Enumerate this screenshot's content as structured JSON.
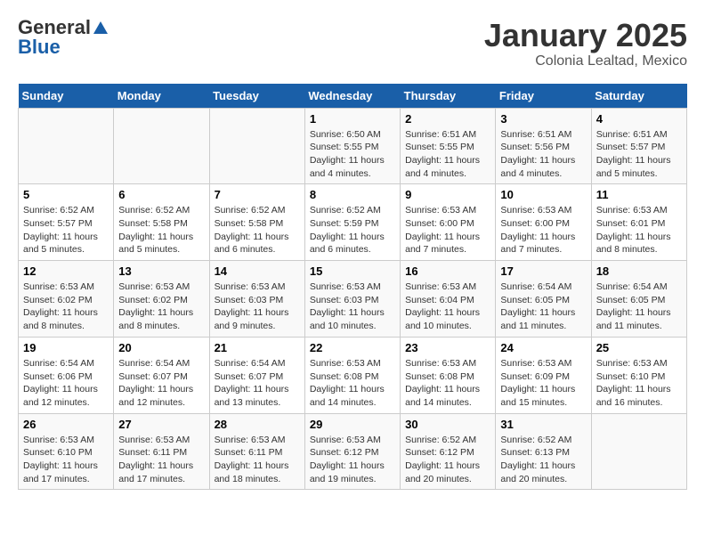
{
  "logo": {
    "general": "General",
    "blue": "Blue"
  },
  "title": "January 2025",
  "subtitle": "Colonia Lealtad, Mexico",
  "days_of_week": [
    "Sunday",
    "Monday",
    "Tuesday",
    "Wednesday",
    "Thursday",
    "Friday",
    "Saturday"
  ],
  "weeks": [
    [
      {
        "num": "",
        "info": ""
      },
      {
        "num": "",
        "info": ""
      },
      {
        "num": "",
        "info": ""
      },
      {
        "num": "1",
        "info": "Sunrise: 6:50 AM\nSunset: 5:55 PM\nDaylight: 11 hours and 4 minutes."
      },
      {
        "num": "2",
        "info": "Sunrise: 6:51 AM\nSunset: 5:55 PM\nDaylight: 11 hours and 4 minutes."
      },
      {
        "num": "3",
        "info": "Sunrise: 6:51 AM\nSunset: 5:56 PM\nDaylight: 11 hours and 4 minutes."
      },
      {
        "num": "4",
        "info": "Sunrise: 6:51 AM\nSunset: 5:57 PM\nDaylight: 11 hours and 5 minutes."
      }
    ],
    [
      {
        "num": "5",
        "info": "Sunrise: 6:52 AM\nSunset: 5:57 PM\nDaylight: 11 hours and 5 minutes."
      },
      {
        "num": "6",
        "info": "Sunrise: 6:52 AM\nSunset: 5:58 PM\nDaylight: 11 hours and 5 minutes."
      },
      {
        "num": "7",
        "info": "Sunrise: 6:52 AM\nSunset: 5:58 PM\nDaylight: 11 hours and 6 minutes."
      },
      {
        "num": "8",
        "info": "Sunrise: 6:52 AM\nSunset: 5:59 PM\nDaylight: 11 hours and 6 minutes."
      },
      {
        "num": "9",
        "info": "Sunrise: 6:53 AM\nSunset: 6:00 PM\nDaylight: 11 hours and 7 minutes."
      },
      {
        "num": "10",
        "info": "Sunrise: 6:53 AM\nSunset: 6:00 PM\nDaylight: 11 hours and 7 minutes."
      },
      {
        "num": "11",
        "info": "Sunrise: 6:53 AM\nSunset: 6:01 PM\nDaylight: 11 hours and 8 minutes."
      }
    ],
    [
      {
        "num": "12",
        "info": "Sunrise: 6:53 AM\nSunset: 6:02 PM\nDaylight: 11 hours and 8 minutes."
      },
      {
        "num": "13",
        "info": "Sunrise: 6:53 AM\nSunset: 6:02 PM\nDaylight: 11 hours and 8 minutes."
      },
      {
        "num": "14",
        "info": "Sunrise: 6:53 AM\nSunset: 6:03 PM\nDaylight: 11 hours and 9 minutes."
      },
      {
        "num": "15",
        "info": "Sunrise: 6:53 AM\nSunset: 6:03 PM\nDaylight: 11 hours and 10 minutes."
      },
      {
        "num": "16",
        "info": "Sunrise: 6:53 AM\nSunset: 6:04 PM\nDaylight: 11 hours and 10 minutes."
      },
      {
        "num": "17",
        "info": "Sunrise: 6:54 AM\nSunset: 6:05 PM\nDaylight: 11 hours and 11 minutes."
      },
      {
        "num": "18",
        "info": "Sunrise: 6:54 AM\nSunset: 6:05 PM\nDaylight: 11 hours and 11 minutes."
      }
    ],
    [
      {
        "num": "19",
        "info": "Sunrise: 6:54 AM\nSunset: 6:06 PM\nDaylight: 11 hours and 12 minutes."
      },
      {
        "num": "20",
        "info": "Sunrise: 6:54 AM\nSunset: 6:07 PM\nDaylight: 11 hours and 12 minutes."
      },
      {
        "num": "21",
        "info": "Sunrise: 6:54 AM\nSunset: 6:07 PM\nDaylight: 11 hours and 13 minutes."
      },
      {
        "num": "22",
        "info": "Sunrise: 6:53 AM\nSunset: 6:08 PM\nDaylight: 11 hours and 14 minutes."
      },
      {
        "num": "23",
        "info": "Sunrise: 6:53 AM\nSunset: 6:08 PM\nDaylight: 11 hours and 14 minutes."
      },
      {
        "num": "24",
        "info": "Sunrise: 6:53 AM\nSunset: 6:09 PM\nDaylight: 11 hours and 15 minutes."
      },
      {
        "num": "25",
        "info": "Sunrise: 6:53 AM\nSunset: 6:10 PM\nDaylight: 11 hours and 16 minutes."
      }
    ],
    [
      {
        "num": "26",
        "info": "Sunrise: 6:53 AM\nSunset: 6:10 PM\nDaylight: 11 hours and 17 minutes."
      },
      {
        "num": "27",
        "info": "Sunrise: 6:53 AM\nSunset: 6:11 PM\nDaylight: 11 hours and 17 minutes."
      },
      {
        "num": "28",
        "info": "Sunrise: 6:53 AM\nSunset: 6:11 PM\nDaylight: 11 hours and 18 minutes."
      },
      {
        "num": "29",
        "info": "Sunrise: 6:53 AM\nSunset: 6:12 PM\nDaylight: 11 hours and 19 minutes."
      },
      {
        "num": "30",
        "info": "Sunrise: 6:52 AM\nSunset: 6:12 PM\nDaylight: 11 hours and 20 minutes."
      },
      {
        "num": "31",
        "info": "Sunrise: 6:52 AM\nSunset: 6:13 PM\nDaylight: 11 hours and 20 minutes."
      },
      {
        "num": "",
        "info": ""
      }
    ]
  ]
}
